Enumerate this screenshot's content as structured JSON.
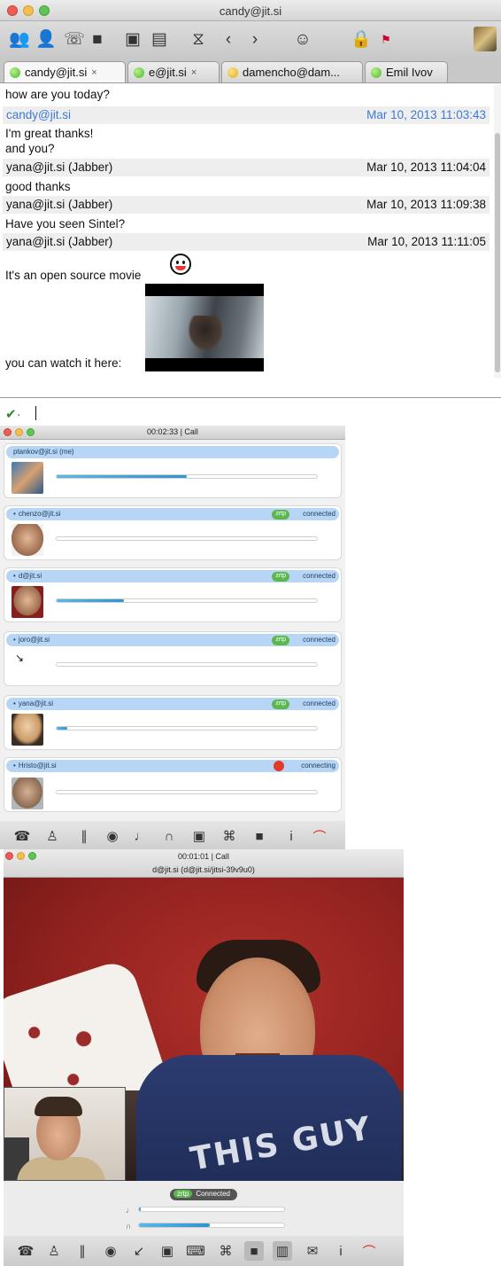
{
  "chat_window": {
    "title": "candy@jit.si",
    "tabs": [
      {
        "label": "candy@jit.si",
        "close": "×",
        "status": "green"
      },
      {
        "label": "e@jit.si",
        "close": "×",
        "status": "green"
      },
      {
        "label": "damencho@dam...",
        "status": "yellow"
      },
      {
        "label": "Emil Ivov",
        "status": "green"
      }
    ],
    "messages": {
      "line1": "how are you today?",
      "hdr1_name": "candy@jit.si",
      "hdr1_time": "Mar 10, 2013 11:03:43",
      "line2": "I'm great thanks!",
      "line3": "and you?",
      "hdr2_name": "yana@jit.si (Jabber)",
      "hdr2_time": "Mar 10, 2013 11:04:04",
      "line4": "good thanks",
      "hdr3_name": "yana@jit.si (Jabber)",
      "hdr3_time": "Mar 10, 2013 11:09:38",
      "line5": "Have you seen Sintel?",
      "hdr4_name": "yana@jit.si (Jabber)",
      "hdr4_time": "Mar 10, 2013 11:11:05",
      "line6": "It's an open source movie",
      "line7": "you can watch it here:"
    },
    "toolbar_icons": [
      "add-contact-icon",
      "contact-icon",
      "call-icon",
      "video-call-icon",
      "desktop-share-icon",
      "send-file-icon",
      "history-icon",
      "back-icon",
      "forward-icon",
      "smiley-icon",
      "lock-icon",
      "language-flag-icon"
    ]
  },
  "conference_window": {
    "title": "00:02:33 | Call",
    "srtp_label": "zrtp",
    "me": {
      "name": "ptankov@jit.si (me)",
      "level": 0.5
    },
    "peers": [
      {
        "name": "chenzo@jit.si",
        "status": "connected",
        "level": 0.0
      },
      {
        "name": "d@jit.si",
        "status": "connected",
        "level": 0.26
      },
      {
        "name": "joro@jit.si",
        "status": "connected",
        "level": 0.0
      },
      {
        "name": "yana@jit.si",
        "status": "connected",
        "level": 0.04
      },
      {
        "name": "Hristo@jit.si",
        "status": "connecting",
        "level": 0.0
      }
    ]
  },
  "video_window": {
    "title": "00:01:01 | Call",
    "subtitle": "d@jit.si (d@jit.si/jitsi-39v9u0)",
    "status_srtp": "zrtp",
    "status": "Connected",
    "mic_level": 0.01,
    "speaker_level": 0.49,
    "shirt_text": "THIS GUY"
  },
  "colors": {
    "accent": "#3d7ad6",
    "peer_bar": "#b7d6f5",
    "secure": "#5cb84e",
    "hangup": "#d9332a"
  }
}
